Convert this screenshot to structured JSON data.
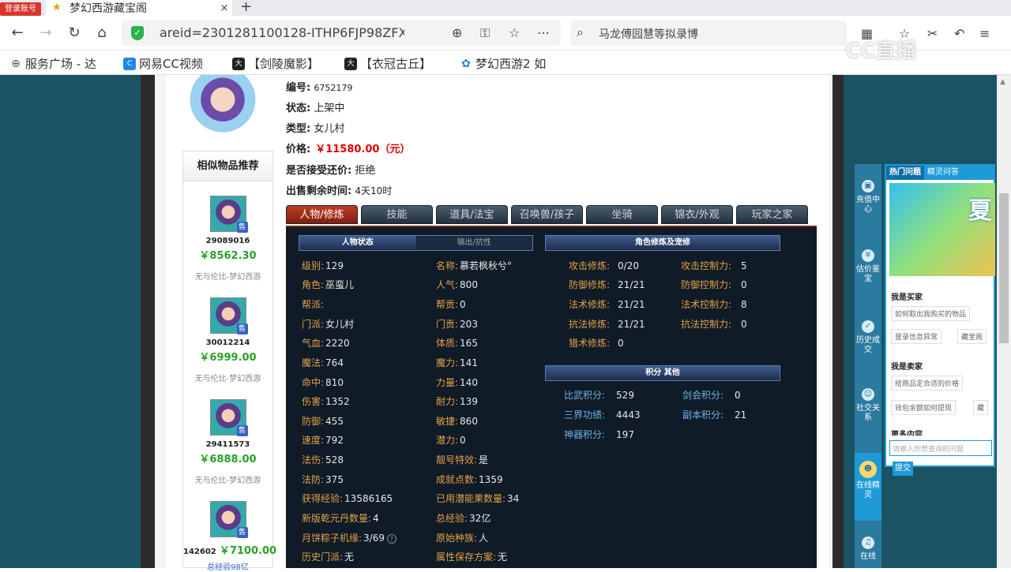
{
  "browser": {
    "register_badge": "登录账号",
    "tab_title": "梦幻西游藏宝阁",
    "tab_close": "×",
    "new_tab": "+",
    "back": "←",
    "forward": "→",
    "reload": "↻",
    "home": "⌂",
    "url": "areid=2301281100128-ITHP6FJP98ZFXYK9",
    "search_text": "马龙傅园慧等拟录博",
    "bookmarks": [
      "服务广场 - 达",
      "网易CC视频",
      "【剑陵魔影】",
      "【衣冠古丘】",
      "梦幻西游2 如"
    ],
    "watermark": "CC直播"
  },
  "item": {
    "id_label": "编号:",
    "id_value": "6752179",
    "status_label": "状态:",
    "status_value": "上架中",
    "type_label": "类型:",
    "type_value": "女儿村",
    "price_label": "价格:",
    "price_value": "￥11580.00（元）",
    "bargain_label": "是否接受还价:",
    "bargain_value": "拒绝",
    "time_label": "出售剩余时间:",
    "time_value": "4天10时"
  },
  "similar": {
    "title": "相似物品推荐",
    "sale_tag": "售",
    "items": [
      {
        "id": "29089016",
        "price": "￥8562.30",
        "sub": "无与伦比-梦幻西游"
      },
      {
        "id": "30012214",
        "price": "￥6999.00",
        "sub": "无与伦比-梦幻西游"
      },
      {
        "id": "29411573",
        "price": "￥6888.00",
        "sub": "无与伦比-梦幻西游"
      },
      {
        "id": "142602",
        "price": "￥7100.00",
        "sub": "总经验98亿"
      }
    ]
  },
  "tabs": [
    "人物/修炼",
    "技能",
    "道具/法宝",
    "召唤兽/孩子",
    "坐骑",
    "锦衣/外观",
    "玩家之家"
  ],
  "sections": {
    "status_tab_a": "人物状态",
    "status_tab_b": "输出/抗性",
    "cultivation": "角色修炼及宠修",
    "points": "积分 其他"
  },
  "stats_left": [
    {
      "k": "级别:",
      "v": "129"
    },
    {
      "k": "角色:",
      "v": "巫蛮儿"
    },
    {
      "k": "帮派:",
      "v": ""
    },
    {
      "k": "门派:",
      "v": "女儿村"
    },
    {
      "k": "气血:",
      "v": "2220"
    },
    {
      "k": "魔法:",
      "v": "764"
    },
    {
      "k": "命中:",
      "v": "810"
    },
    {
      "k": "伤害:",
      "v": "1352"
    },
    {
      "k": "防御:",
      "v": "455"
    },
    {
      "k": "速度:",
      "v": "792"
    },
    {
      "k": "法伤:",
      "v": "528"
    },
    {
      "k": "法防:",
      "v": "375"
    },
    {
      "k": "获得经验:",
      "v": "13586165"
    },
    {
      "k": "新版乾元丹数量:",
      "v": "4"
    },
    {
      "k": "月饼粽子机缘:",
      "v": "3/69"
    },
    {
      "k": "历史门派:",
      "v": "无"
    }
  ],
  "stats_right": [
    {
      "k": "名称:",
      "v": "慕若枫秋兮°"
    },
    {
      "k": "人气:",
      "v": "800"
    },
    {
      "k": "帮贡:",
      "v": "0"
    },
    {
      "k": "门贡:",
      "v": "203"
    },
    {
      "k": "体质:",
      "v": "165"
    },
    {
      "k": "魔力:",
      "v": "141"
    },
    {
      "k": "力量:",
      "v": "140"
    },
    {
      "k": "耐力:",
      "v": "139"
    },
    {
      "k": "敏捷:",
      "v": "860"
    },
    {
      "k": "潜力:",
      "v": "0"
    },
    {
      "k": "靓号特效:",
      "v": "是"
    },
    {
      "k": "成就点数:",
      "v": "1359"
    },
    {
      "k": "已用潜能果数量:",
      "v": "34"
    },
    {
      "k": "总经验:",
      "v": "32亿"
    },
    {
      "k": "原始种族:",
      "v": "人"
    },
    {
      "k": "属性保存方案:",
      "v": "无"
    }
  ],
  "cultivation_left": [
    {
      "k": "攻击修炼:",
      "v": "0/20"
    },
    {
      "k": "防御修炼:",
      "v": "21/21"
    },
    {
      "k": "法术修炼:",
      "v": "21/21"
    },
    {
      "k": "抗法修炼:",
      "v": "21/21"
    },
    {
      "k": "猎术修炼:",
      "v": "0"
    }
  ],
  "cultivation_right": [
    {
      "k": "攻击控制力:",
      "v": "5"
    },
    {
      "k": "防御控制力:",
      "v": "0"
    },
    {
      "k": "法术控制力:",
      "v": "8"
    },
    {
      "k": "抗法控制力:",
      "v": "0"
    }
  ],
  "points": [
    {
      "k": "比武积分:",
      "v": "529"
    },
    {
      "k": "剑会积分:",
      "v": "0"
    },
    {
      "k": "三界功绩:",
      "v": "4443"
    },
    {
      "k": "副本积分:",
      "v": "21"
    },
    {
      "k": "神器积分:",
      "v": "197"
    }
  ],
  "sidebar": [
    {
      "label": "充值中心"
    },
    {
      "label": "估价鉴宝"
    },
    {
      "label": "历史成交"
    },
    {
      "label": "社交关系"
    },
    {
      "label": "在线精灵"
    },
    {
      "label": "在线"
    }
  ],
  "help": {
    "tab_a": "热门问题",
    "tab_b": "精灵问答",
    "promo_text": "夏",
    "buyer": "我是买家",
    "buyer_links": [
      "如何取出我购买的物品",
      "登录信息异常",
      "藏宝阁"
    ],
    "seller": "我是卖家",
    "seller_links": [
      "给商品定合适的价格",
      "钱包余额如何提现",
      "藏"
    ],
    "more": "更多内容",
    "input_placeholder": "请输入你想查询的问题",
    "submit": "提交"
  }
}
